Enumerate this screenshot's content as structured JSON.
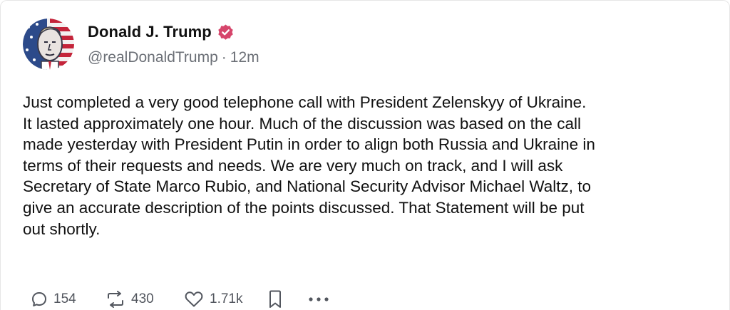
{
  "author": {
    "display_name": "Donald J. Trump",
    "handle": "@realDonaldTrump",
    "separator": "·",
    "time_ago": "12m",
    "verified": true,
    "verified_color": "#d6456b"
  },
  "post": {
    "lines": [
      "Just completed a very good telephone call with President Zelenskyy of Ukraine.",
      "It lasted approximately one hour. Much of the discussion was based on the call",
      "made yesterday with President Putin in order to align both Russia and Ukraine in",
      "terms of their requests and needs. We are very much on track, and I will ask",
      "Secretary of State Marco Rubio, and National Security Advisor Michael Waltz, to",
      "give an accurate description of the points discussed. That Statement will be put",
      "out shortly."
    ]
  },
  "actions": {
    "replies": "154",
    "reposts": "430",
    "likes": "1.71k",
    "icons": [
      "reply-icon",
      "repost-icon",
      "heart-icon",
      "bookmark-icon",
      "more-icon"
    ]
  }
}
